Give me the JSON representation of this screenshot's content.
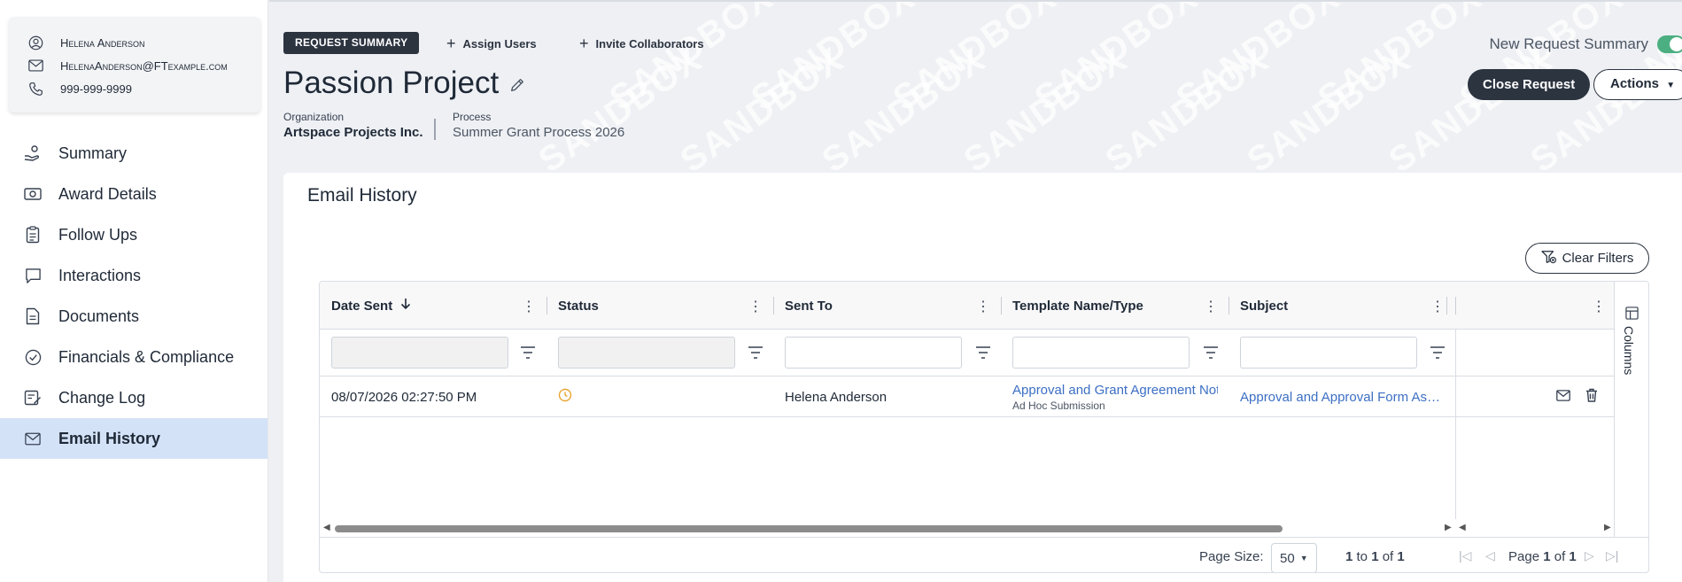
{
  "contact": {
    "name": "Helena Anderson",
    "email": "HelenaAnderson@FTexample.com",
    "phone": "999-999-9999"
  },
  "nav": {
    "items": [
      {
        "label": "Summary",
        "icon": "hand-coin-icon"
      },
      {
        "label": "Award Details",
        "icon": "banknote-icon"
      },
      {
        "label": "Follow Ups",
        "icon": "clipboard-icon"
      },
      {
        "label": "Interactions",
        "icon": "chat-bubble-icon"
      },
      {
        "label": "Documents",
        "icon": "document-icon"
      },
      {
        "label": "Financials & Compliance",
        "icon": "check-circle-icon"
      },
      {
        "label": "Change Log",
        "icon": "edit-document-icon"
      },
      {
        "label": "Email History",
        "icon": "envelope-icon"
      }
    ],
    "active_index": 7
  },
  "header": {
    "badge": "REQUEST SUMMARY",
    "assign_users": "Assign Users",
    "invite_collaborators": "Invite Collaborators",
    "title": "Passion Project",
    "organization_label": "Organization",
    "organization_value": "Artspace Projects Inc.",
    "process_label": "Process",
    "process_value": "Summer Grant Process 2026",
    "new_request_summary": "New Request Summary",
    "new_request_summary_on": true,
    "close_request": "Close Request",
    "actions": "Actions",
    "watermark": "SANDBOX"
  },
  "panel": {
    "title": "Email History",
    "clear_filters": "Clear Filters"
  },
  "grid": {
    "columns": [
      {
        "label": "Date Sent",
        "sorted": "desc"
      },
      {
        "label": "Status"
      },
      {
        "label": "Sent To"
      },
      {
        "label": "Template Name/Type"
      },
      {
        "label": "Subject"
      },
      {
        "label": ""
      }
    ],
    "rows": [
      {
        "date_sent": "08/07/2026 02:27:50 PM",
        "status_icon": "clock-icon",
        "sent_to": "Helena Anderson",
        "template_name": "Approval and Grant Agreement Notification",
        "template_type": "Ad Hoc Submission",
        "subject": "Approval and Approval Form Assigned"
      }
    ],
    "side_tab": "Columns",
    "page_size_label": "Page Size:",
    "page_size": "50",
    "range_from": "1",
    "range_to": "1",
    "range_total": "1",
    "range_sep_to": "to",
    "range_sep_of": "of",
    "page_label": "Page",
    "page_current": "1",
    "page_of": "of",
    "page_total": "1"
  },
  "colors": {
    "dark": "#2c3440",
    "active_nav": "#d4e2f8",
    "link": "#3c6fc4",
    "toggle_on": "#4caf82",
    "status_pending": "#e8a534"
  }
}
